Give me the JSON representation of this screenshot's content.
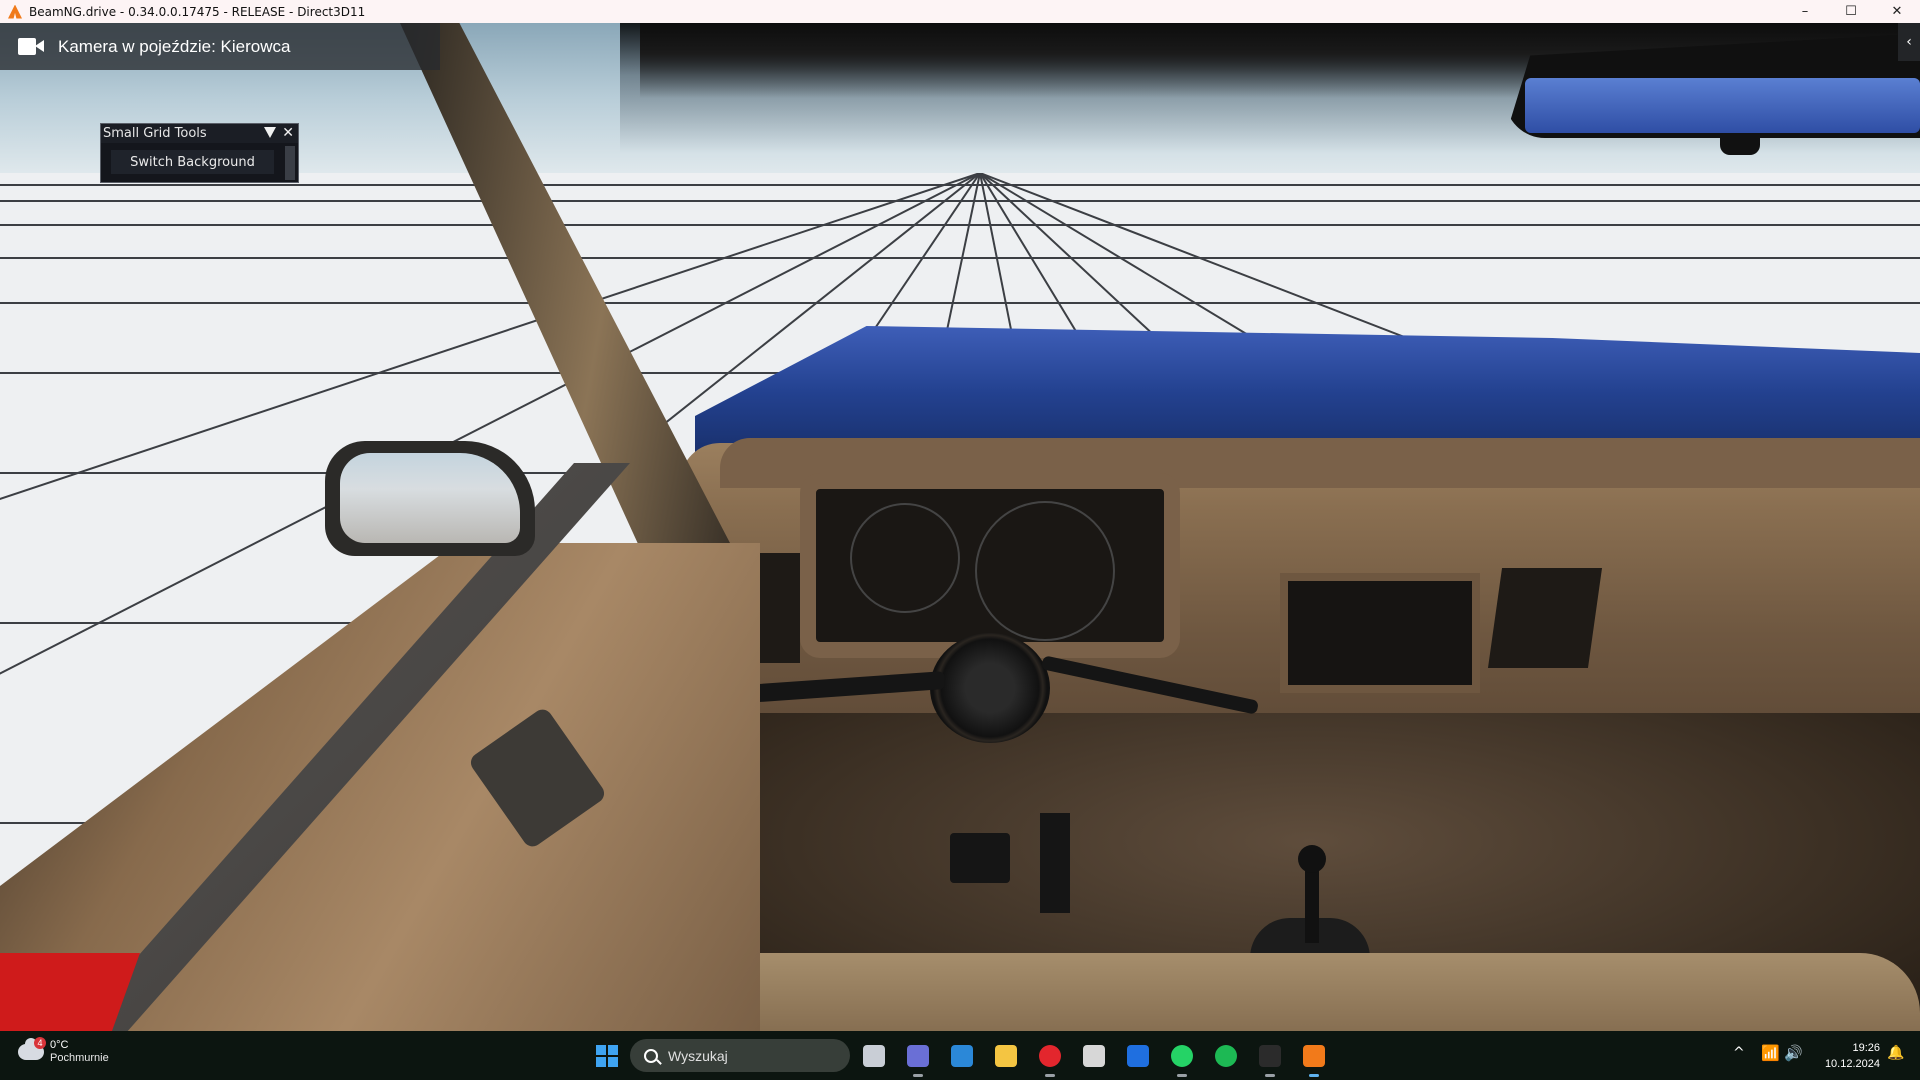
{
  "window": {
    "title": "BeamNG.drive - 0.34.0.0.17475 - RELEASE - Direct3D11",
    "minimize": "–",
    "maximize": "☐",
    "close": "✕"
  },
  "camera": {
    "label": "Kamera w pojeździe: Kierowca",
    "icon": "video-camera-icon",
    "toggle": "‹"
  },
  "small_grid_tools": {
    "title": "Small Grid Tools",
    "collapse_icon": "triangle-down-icon",
    "close_label": "✕",
    "switch_label": "Switch Background"
  },
  "taskbar": {
    "weather": {
      "temp": "0°C",
      "condition": "Pochmurnie",
      "badge": "4"
    },
    "search_placeholder": "Wyszukaj",
    "apps": [
      {
        "name": "task-view",
        "color": "#c9ced6"
      },
      {
        "name": "teams",
        "color": "#6a6fd6"
      },
      {
        "name": "microsoft-store",
        "color": "#2b88d8"
      },
      {
        "name": "file-explorer",
        "color": "#f4c542"
      },
      {
        "name": "opera",
        "color": "#e3262d"
      },
      {
        "name": "unity",
        "color": "#d7d7d7"
      },
      {
        "name": "app-blue",
        "color": "#1f6fe0"
      },
      {
        "name": "whatsapp",
        "color": "#25d366"
      },
      {
        "name": "spotify",
        "color": "#1db954"
      },
      {
        "name": "terminal",
        "color": "#2b2b2b"
      },
      {
        "name": "beamng",
        "color": "#f27a1a"
      }
    ],
    "tray": {
      "chevron": "^",
      "wifi": "📶",
      "volume": "🔊",
      "notifications": "🔔"
    },
    "clock": {
      "time": "19:26",
      "date": "10.12.2024"
    }
  }
}
